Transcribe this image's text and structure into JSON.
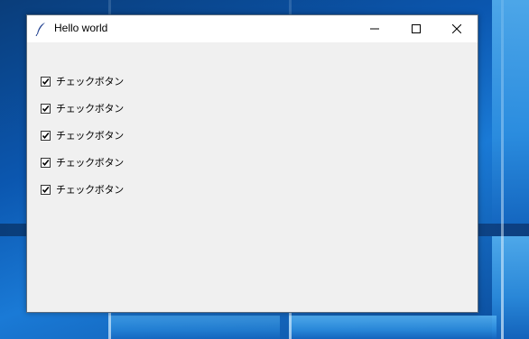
{
  "window": {
    "title": "Hello world",
    "icon": "feather-icon"
  },
  "titlebar_buttons": [
    "minimize-icon",
    "maximize-icon",
    "close-icon"
  ],
  "checkbuttons": [
    {
      "label": "チェックボタン",
      "checked": true
    },
    {
      "label": "チェックボタン",
      "checked": true
    },
    {
      "label": "チェックボタン",
      "checked": true
    },
    {
      "label": "チェックボタン",
      "checked": true
    },
    {
      "label": "チェックボタン",
      "checked": true
    }
  ]
}
